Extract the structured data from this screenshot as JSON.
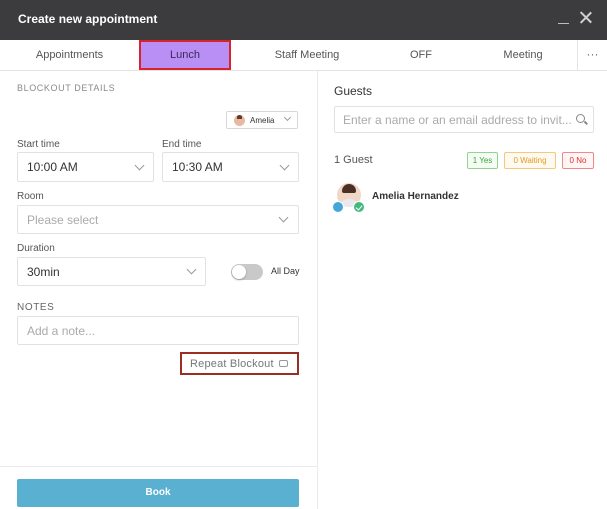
{
  "window": {
    "title": "Create new appointment"
  },
  "tabs": [
    {
      "label": "Appointments"
    },
    {
      "label": "Lunch"
    },
    {
      "label": "Staff Meeting"
    },
    {
      "label": "OFF"
    },
    {
      "label": "Meeting"
    }
  ],
  "tabs_more": "···",
  "blockout": {
    "section_label": "BLOCKOUT DETAILS",
    "employee": "Amelia",
    "start_time_label": "Start time",
    "start_time": "10:00 AM",
    "end_time_label": "End time",
    "end_time": "10:30 AM",
    "room_label": "Room",
    "room_placeholder": "Please select",
    "duration_label": "Duration",
    "duration": "30min",
    "all_day_label": "All Day",
    "notes_label": "NOTES",
    "notes_placeholder": "Add a note...",
    "repeat_label": "Repeat Blockout"
  },
  "footer": {
    "book_label": "Book"
  },
  "guests": {
    "title": "Guests",
    "search_placeholder": "Enter a name or an email address to invit...",
    "count_label": "1 Guest",
    "yes_badge": "1 Yes",
    "waiting_badge": "0 Waiting",
    "no_badge": "0 No",
    "list": [
      {
        "name": "Amelia Hernandez"
      }
    ]
  },
  "icons": {
    "minimize": "minimize-icon",
    "close": "close-icon",
    "search": "search-icon",
    "chevron": "chevron-down-icon",
    "repeat": "repeat-icon"
  },
  "colors": {
    "titlebar": "#3c3c3e",
    "active_tab": "#b98ff5",
    "book_button": "#5ab0d0",
    "yes": "#3aa63a",
    "waiting": "#e39a1a",
    "no": "#d9332b"
  }
}
